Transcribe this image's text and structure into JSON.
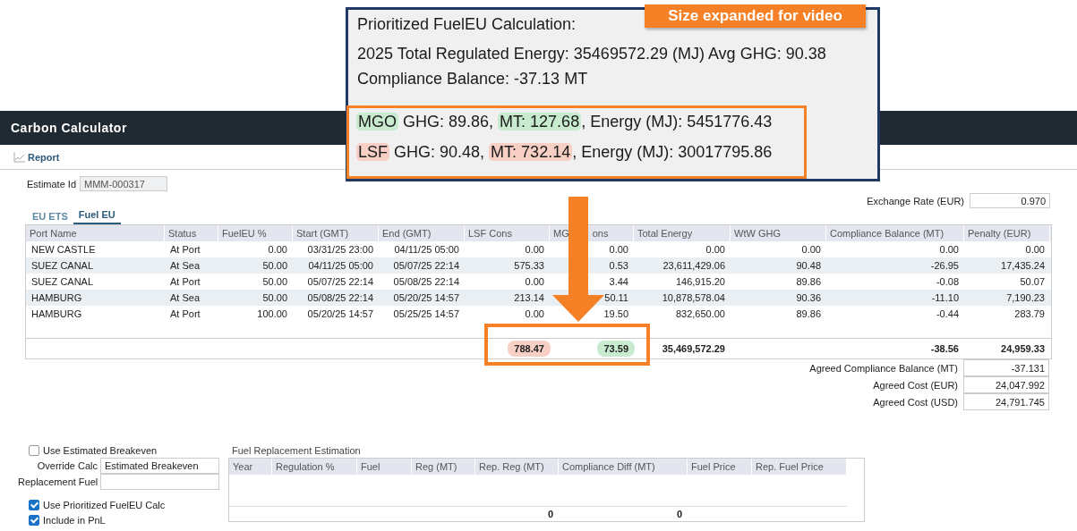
{
  "app": {
    "title": "Carbon Calculator",
    "toolbar": {
      "report": "Report"
    },
    "estimate": {
      "label": "Estimate Id",
      "value": "MMM-000317"
    },
    "exchange_rate": {
      "label": "Exchange Rate (EUR)",
      "value": "0.970"
    },
    "tabs": [
      {
        "label": "EU ETS",
        "selected": false
      },
      {
        "label": "Fuel EU",
        "selected": true
      }
    ],
    "table": {
      "columns": [
        {
          "label_parts": [
            "Port Name"
          ]
        },
        {
          "label_parts": [
            "Status"
          ]
        },
        {
          "label_parts": [
            "FuelEU %"
          ]
        },
        {
          "label_parts": [
            "Start (GMT)"
          ]
        },
        {
          "label_parts": [
            "End (GMT)"
          ]
        },
        {
          "label_parts": [
            "LSF Cons"
          ]
        },
        {
          "label_parts": [
            "MG",
            "ons"
          ]
        },
        {
          "label_parts": [
            "Total Energy"
          ]
        },
        {
          "label_parts": [
            "WtW GHG"
          ]
        },
        {
          "label_parts": [
            "Compliance Balance (MT)"
          ]
        },
        {
          "label_parts": [
            "Penalty (EUR)"
          ]
        }
      ],
      "rows": [
        [
          "NEW CASTLE",
          "At Port",
          "0.00",
          "03/31/25 23:00",
          "04/11/25 05:00",
          "0.00",
          "0.00",
          "0.00",
          "0.00",
          "0.00",
          "0.00"
        ],
        [
          "SUEZ CANAL",
          "At Sea",
          "50.00",
          "04/11/25 05:00",
          "05/07/25 22:14",
          "575.33",
          "0.53",
          "23,611,429.06",
          "90.48",
          "-26.95",
          "17,435.24"
        ],
        [
          "SUEZ CANAL",
          "At Port",
          "50.00",
          "05/07/25 22:14",
          "05/08/25 22:14",
          "0.00",
          "3.44",
          "146,915.20",
          "89.86",
          "-0.08",
          "50.07"
        ],
        [
          "HAMBURG",
          "At Sea",
          "50.00",
          "05/08/25 22:14",
          "05/20/25 14:57",
          "213.14",
          "50.11",
          "10,878,578.04",
          "90.36",
          "-11.10",
          "7,190.23"
        ],
        [
          "HAMBURG",
          "At Port",
          "100.00",
          "05/20/25 14:57",
          "05/25/25 14:57",
          "0.00",
          "19.50",
          "832,650.00",
          "89.86",
          "-0.44",
          "283.79"
        ]
      ],
      "totals": {
        "lsf_cons": {
          "value": "788.47",
          "color": "#f7cfc5"
        },
        "mgo_cons": {
          "value": "73.59",
          "color": "#c8ebcf"
        },
        "total_energy": {
          "value": "35,469,572.29"
        },
        "compliance_balance": {
          "value": "-38.56"
        },
        "penalty": {
          "value": "24,959.33"
        }
      }
    },
    "agreed": [
      {
        "label": "Agreed Compliance Balance (MT)",
        "value": "-37.131"
      },
      {
        "label": "Agreed Cost (EUR)",
        "value": "24,047.992"
      },
      {
        "label": "Agreed Cost (USD)",
        "value": "24,791.745"
      }
    ],
    "use_estimated_breakeven": {
      "label": "Use Estimated Breakeven",
      "checked": false
    },
    "override_calc": {
      "label": "Override Calc",
      "value": "Estimated Breakeven"
    },
    "replacement_fuel": {
      "label": "Replacement Fuel"
    },
    "use_prioritized": {
      "label": "Use Prioritized FuelEU Calc",
      "checked": true
    },
    "include_pnl": {
      "label": "Include in PnL",
      "checked": true
    },
    "replacement": {
      "title": "Fuel Replacement Estimation",
      "columns": [
        "Year",
        "Regulation %",
        "Fuel",
        "Reg (MT)",
        "Rep. Reg (MT)",
        "Compliance Diff (MT)",
        "Fuel Price",
        "Rep. Fuel Price"
      ],
      "totals": {
        "rep_reg": "0",
        "compliance_diff": "0"
      }
    }
  },
  "callout": {
    "badge": "Size expanded for video",
    "heading": "Prioritized FuelEU Calculation:",
    "summary": "2025 Total Regulated Energy: 35469572.29 (MJ) Avg GHG: 90.38 Compliance Balance: -37.13 MT",
    "fuel_lines": [
      {
        "fuel": "MGO",
        "ghg": "GHG: 89.86,",
        "mt": "MT: 127.68",
        "energy": ", Energy (MJ): 5451776.43",
        "color": "#c8ebcf"
      },
      {
        "fuel": "LSF",
        "ghg": "GHG: 90.48,",
        "mt": "MT: 732.14",
        "energy": ", Energy (MJ): 30017795.86",
        "color": "#f7cfc5"
      }
    ]
  }
}
